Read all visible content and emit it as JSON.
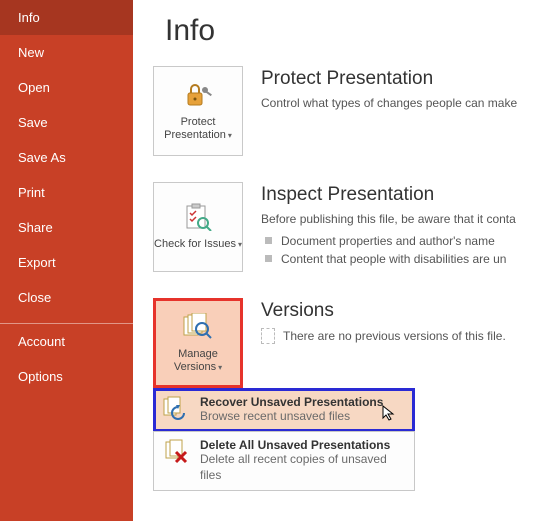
{
  "sidebar": {
    "items": [
      {
        "label": "Info",
        "active": true
      },
      {
        "label": "New"
      },
      {
        "label": "Open"
      },
      {
        "label": "Save"
      },
      {
        "label": "Save As"
      },
      {
        "label": "Print"
      },
      {
        "label": "Share"
      },
      {
        "label": "Export"
      },
      {
        "label": "Close"
      }
    ],
    "items2": [
      {
        "label": "Account"
      },
      {
        "label": "Options"
      }
    ]
  },
  "page_title": "Info",
  "protect": {
    "button": "Protect Presentation",
    "heading": "Protect Presentation",
    "desc": "Control what types of changes people can make"
  },
  "inspect": {
    "button": "Check for Issues",
    "heading": "Inspect Presentation",
    "desc": "Before publishing this file, be aware that it conta",
    "bullets": [
      "Document properties and author's name",
      "Content that people with disabilities are un"
    ]
  },
  "versions": {
    "button": "Manage Versions",
    "heading": "Versions",
    "desc": "There are no previous versions of this file."
  },
  "menu": {
    "recover": {
      "title": "Recover Unsaved Presentations",
      "sub": "Browse recent unsaved files"
    },
    "delete": {
      "title": "Delete All Unsaved Presentations",
      "sub": "Delete all recent copies of unsaved files"
    }
  }
}
